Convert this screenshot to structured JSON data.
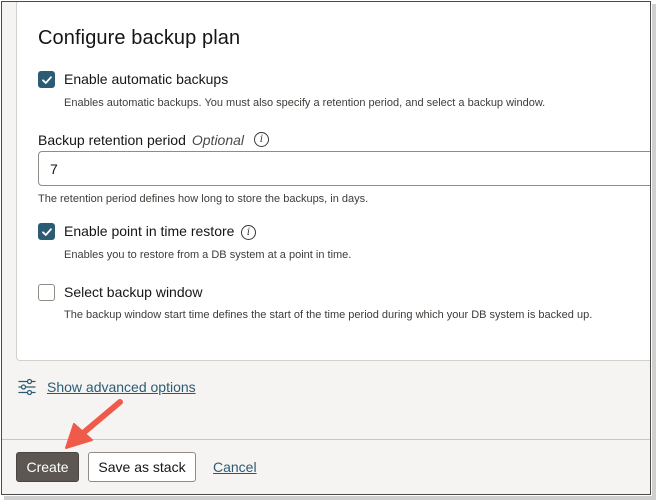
{
  "section": {
    "title": "Configure backup plan"
  },
  "automatic_backups": {
    "label": "Enable automatic backups",
    "checked": true,
    "help": "Enables automatic backups. You must also specify a retention period, and select a backup window."
  },
  "retention": {
    "label": "Backup retention period",
    "optional": "Optional",
    "value": "7",
    "help": "The retention period defines how long to store the backups, in days."
  },
  "pitr": {
    "label": "Enable point in time restore",
    "checked": true,
    "help": "Enables you to restore from a DB system at a point in time."
  },
  "backup_window": {
    "label": "Select backup window",
    "checked": false,
    "help": "The backup window start time defines the start of the time period during which your DB system is backed up."
  },
  "advanced": {
    "link": "Show advanced options",
    "icon": "sliders-icon"
  },
  "footer": {
    "create": "Create",
    "save_stack": "Save as stack",
    "cancel": "Cancel"
  },
  "colors": {
    "accent": "#2c5c74",
    "primary_button": "#5c5752",
    "arrow": "#f05a4a"
  }
}
